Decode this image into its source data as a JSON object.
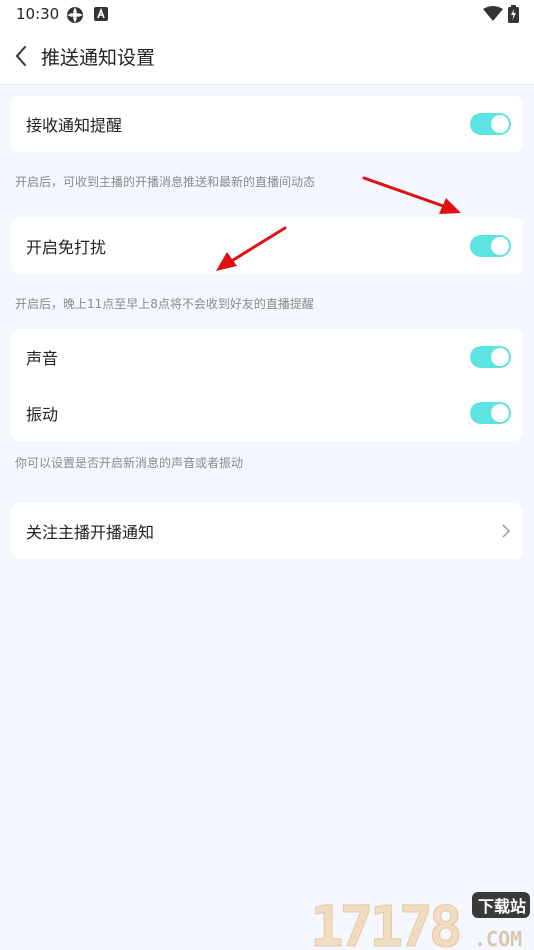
{
  "status_bar": {
    "time": "10:30"
  },
  "header": {
    "title": "推送通知设置"
  },
  "sections": [
    {
      "label": "接收通知提醒",
      "toggle_on": true,
      "hint": "开启后，可收到主播的开播消息推送和最新的直播间动态"
    },
    {
      "label": "开启免打扰",
      "toggle_on": true,
      "hint": "开启后，晚上11点至早上8点将不会收到好友的直播提醒"
    }
  ],
  "sound_vibrate": {
    "sound_label": "声音",
    "vibrate_label": "振动",
    "hint": "你可以设置是否开启新消息的声音或者振动"
  },
  "follow_row": {
    "label": "关注主播开播通知"
  },
  "watermark": {
    "number": "17178",
    "badge": "下载站",
    "suffix": ".COM"
  },
  "colors": {
    "toggle_on": "#5de3e1",
    "background": "#f5f7fe",
    "annotation_arrow": "#e01010"
  }
}
